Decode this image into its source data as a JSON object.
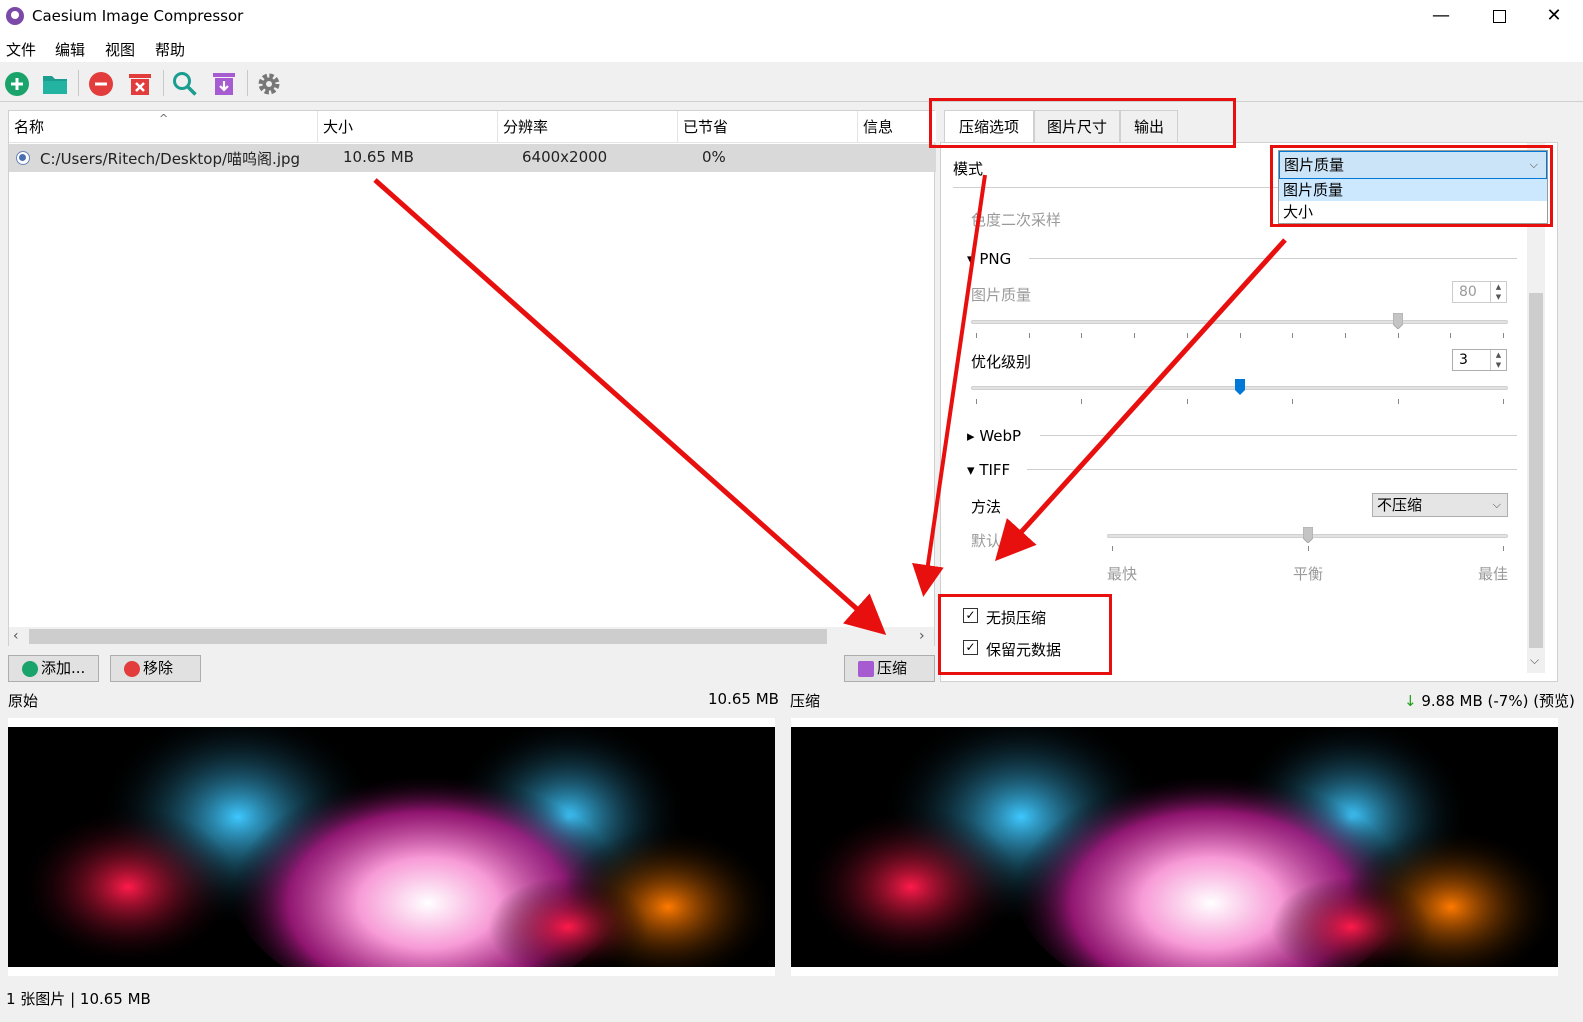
{
  "window": {
    "title": "Caesium Image Compressor",
    "minimize": "—",
    "close": "✕"
  },
  "menu": [
    "文件",
    "编辑",
    "视图",
    "帮助"
  ],
  "toolbar_icons": [
    "add-file-icon",
    "open-folder-icon",
    "remove-icon",
    "clear-list-icon",
    "preview-icon",
    "compress-icon",
    "settings-icon"
  ],
  "file_list": {
    "columns": [
      "名称",
      "大小",
      "分辨率",
      "已节省",
      "信息"
    ],
    "rows": [
      {
        "name": "C:/Users/Ritech/Desktop/喵呜阁.jpg",
        "size": "10.65 MB",
        "resolution": "6400x2000",
        "saved": "0%",
        "info": ""
      }
    ]
  },
  "buttons": {
    "add": "添加...",
    "remove": "移除",
    "compress": "压缩"
  },
  "tabs": [
    "压缩选项",
    "图片尺寸",
    "输出"
  ],
  "options": {
    "mode_label": "模式",
    "mode_value": "图片质量",
    "mode_options": [
      "图片质量",
      "大小"
    ],
    "chroma_label": "色度二次采样",
    "png_title": "PNG",
    "png_quality_label": "图片质量",
    "png_quality_value": "80",
    "png_quality_level": 80,
    "optimization_label": "优化级别",
    "optimization_value": "3",
    "optimization_level": 3,
    "webp_title": "WebP",
    "tiff_title": "TIFF",
    "method_label": "方法",
    "method_value": "不压缩",
    "deflate_label": "默认",
    "deflate_ticks": [
      "最快",
      "平衡",
      "最佳"
    ],
    "lossless_label": "无损压缩",
    "lossless_checked": true,
    "keep_metadata_label": "保留元数据",
    "keep_metadata_checked": true
  },
  "preview": {
    "original_label": "原始",
    "original_size": "10.65 MB",
    "compressed_label": "压缩",
    "compressed_size": "9.88 MB (-7%) (预览)"
  },
  "status": "1 张图片 | 10.65 MB",
  "colors": {
    "annotation_red": "#e8100f",
    "accent_blue": "#0078d7",
    "add_green": "#1aa36b",
    "remove_red": "#e23c3c",
    "folder_teal": "#1b9e8f",
    "compress_purple": "#a65bd1",
    "saving_green": "#1ea21e"
  }
}
